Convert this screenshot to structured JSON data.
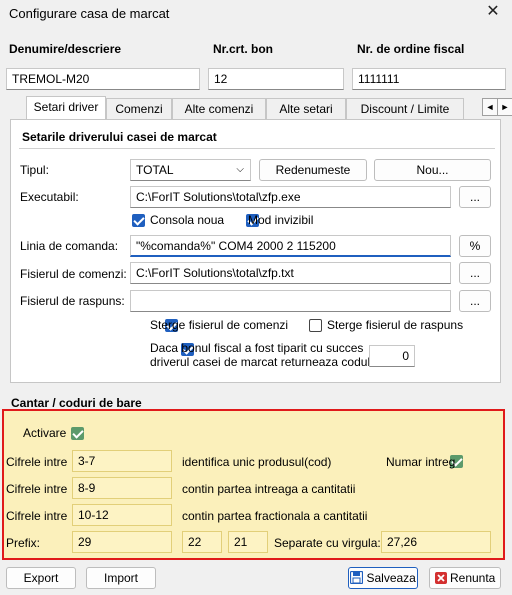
{
  "window": {
    "title": "Configurare casa de marcat",
    "close_glyph": "✕"
  },
  "header": {
    "col1_label": "Denumire/descriere",
    "col2_label": "Nr.crt. bon",
    "col3_label": "Nr. de ordine fiscal",
    "col1_value": "TREMOL-M20",
    "col2_value": "12",
    "col3_value": "1111111"
  },
  "tabs": [
    {
      "label": "Setari driver",
      "active": true
    },
    {
      "label": "Comenzi",
      "active": false
    },
    {
      "label": "Alte comenzi",
      "active": false
    },
    {
      "label": "Alte setari",
      "active": false
    },
    {
      "label": "Discount / Limite",
      "active": false
    }
  ],
  "tab_scroll": {
    "left": "◄",
    "right": "►"
  },
  "driver": {
    "group_title": "Setarile driverului casei de marcat",
    "tipul_label": "Tipul:",
    "tipul_value": "TOTAL",
    "redenumeste_label": "Redenumeste",
    "nou_label": "Nou...",
    "executabil_label": "Executabil:",
    "executabil_value": "C:\\ForIT Solutions\\total\\zfp.exe",
    "browse_label": "...",
    "consola_label": "Consola noua",
    "mod_invizibil_label": "Mod invizibil",
    "linia_label": "Linia de comanda:",
    "linia_value": "\"%comanda%\" COM4 2000 2 115200",
    "percent_label": "%",
    "fisier_comenzi_label": "Fisierul de comenzi:",
    "fisier_comenzi_value": "C:\\ForIT Solutions\\total\\zfp.txt",
    "fisier_raspuns_label": "Fisierul de raspuns:",
    "fisier_raspuns_value": "",
    "sterge_comenzi_label": "Sterge fisierul de comenzi",
    "sterge_raspuns_label": "Sterge fisierul de raspuns",
    "daca_line1": "Daca bonul fiscal a fost tiparit cu succes",
    "daca_line2": "driverul casei de marcat returneaza codul",
    "cod_value": "0"
  },
  "cantar": {
    "section_title": "Cantar / coduri de bare",
    "activare_label": "Activare",
    "rows": [
      {
        "label": "Cifrele intre",
        "value": "3-7",
        "desc": "identifica unic produsul(cod)"
      },
      {
        "label": "Cifrele intre",
        "value": "8-9",
        "desc": "contin partea intreaga a cantitatii"
      },
      {
        "label": "Cifrele intre",
        "value": "10-12",
        "desc": "contin partea fractionala a cantitatii"
      }
    ],
    "numar_intreg_label": "Numar intreg",
    "prefix_label": "Prefix:",
    "prefix_values": [
      "29",
      "22",
      "21"
    ],
    "separate_label": "Separate cu virgula:",
    "separate_value": "27,26"
  },
  "footer": {
    "export_label": "Export",
    "import_label": "Import",
    "save_label": "Salveaza",
    "cancel_label": "Renunta",
    "save_icon_color": "#1f5fbf",
    "cancel_icon_color": "#d32f2f"
  }
}
